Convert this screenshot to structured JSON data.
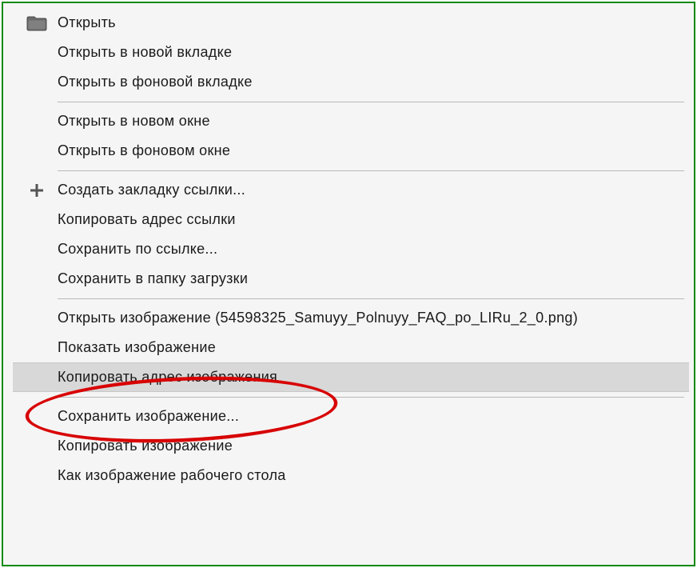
{
  "menu": {
    "groups": [
      [
        {
          "id": "open",
          "label": "Открыть",
          "icon": "folder"
        },
        {
          "id": "open-new-tab",
          "label": "Открыть в новой вкладке"
        },
        {
          "id": "open-bg-tab",
          "label": "Открыть в фоновой вкладке"
        }
      ],
      [
        {
          "id": "open-new-window",
          "label": "Открыть в новом окне"
        },
        {
          "id": "open-bg-window",
          "label": "Открыть в фоновом окне"
        }
      ],
      [
        {
          "id": "bookmark-link",
          "label": "Создать закладку ссылки...",
          "icon": "plus"
        },
        {
          "id": "copy-link-address",
          "label": "Копировать адрес ссылки"
        },
        {
          "id": "save-link-as",
          "label": "Сохранить по ссылке..."
        },
        {
          "id": "save-to-downloads",
          "label": "Сохранить в папку загрузки"
        }
      ],
      [
        {
          "id": "open-image",
          "label": "Открыть изображение (54598325_Samuyy_Polnuyy_FAQ_po_LIRu_2_0.png)"
        },
        {
          "id": "show-image",
          "label": "Показать изображение"
        },
        {
          "id": "copy-image-address",
          "label": "Копировать адрес изображения",
          "highlight": true
        }
      ],
      [
        {
          "id": "save-image-as",
          "label": "Сохранить изображение..."
        },
        {
          "id": "copy-image",
          "label": "Копировать изображение"
        },
        {
          "id": "set-as-wallpaper",
          "label": "Как изображение рабочего стола"
        }
      ]
    ]
  },
  "annotation": {
    "target_item_id": "copy-image-address",
    "shape": "ellipse",
    "color": "#d80000"
  }
}
